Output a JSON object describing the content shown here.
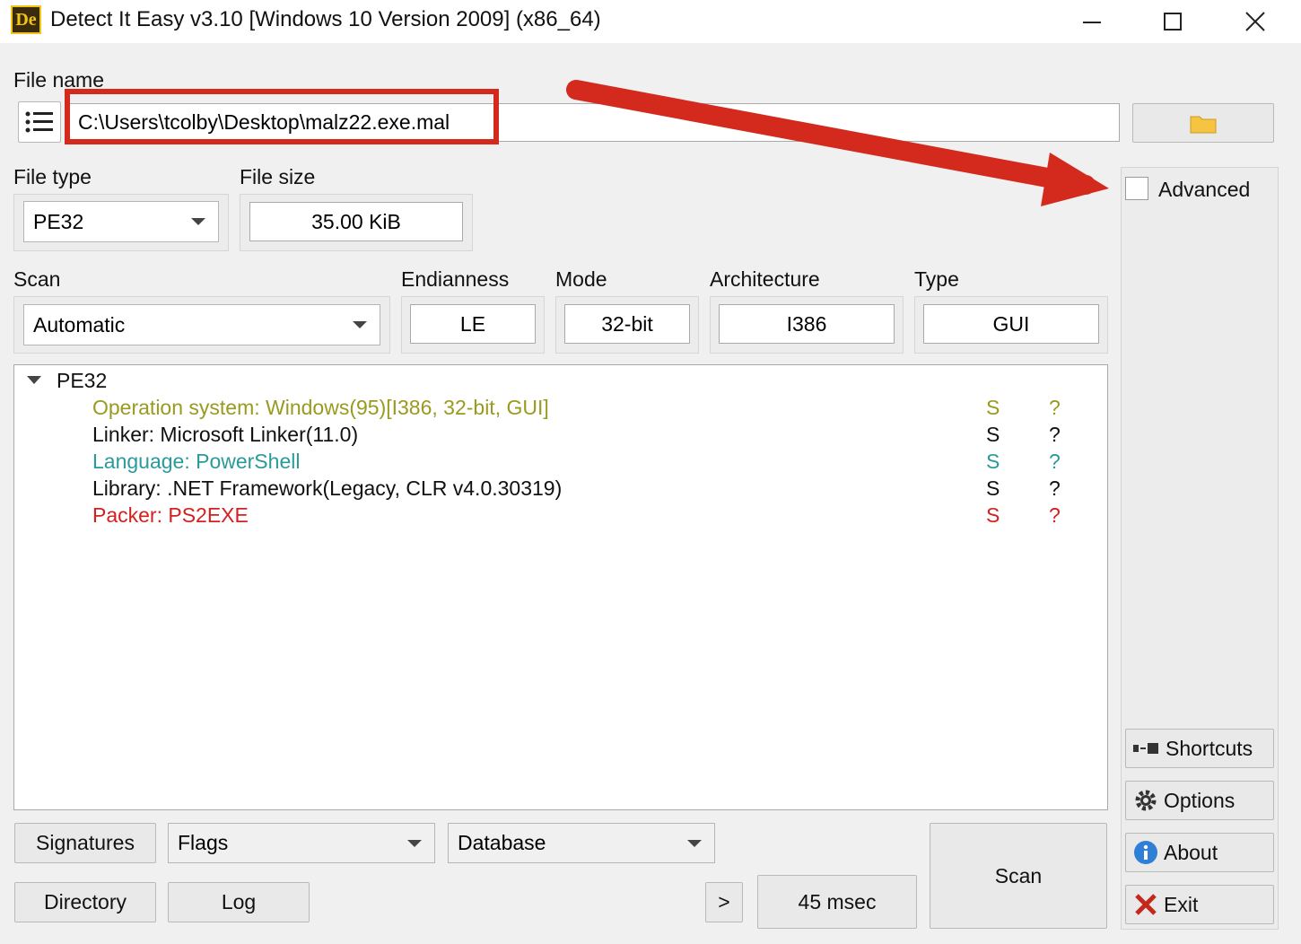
{
  "window": {
    "title": "Detect It Easy v3.10 [Windows 10 Version 2009] (x86_64)",
    "icon_text": "De"
  },
  "file": {
    "label": "File name",
    "path": "C:\\Users\\tcolby\\Desktop\\malz22.exe.mal"
  },
  "file_type": {
    "label": "File type",
    "value": "PE32"
  },
  "file_size": {
    "label": "File size",
    "value": "35.00 KiB"
  },
  "advanced": {
    "label": "Advanced",
    "checked": false
  },
  "scan": {
    "label": "Scan",
    "value": "Automatic"
  },
  "endianness": {
    "label": "Endianness",
    "value": "LE"
  },
  "mode": {
    "label": "Mode",
    "value": "32-bit"
  },
  "architecture": {
    "label": "Architecture",
    "value": "I386"
  },
  "type": {
    "label": "Type",
    "value": "GUI"
  },
  "results": {
    "root": "PE32",
    "items": [
      {
        "text": "Operation system: Windows(95)[I386, 32-bit, GUI]",
        "s": "S",
        "q": "?",
        "color": "#9a9a20"
      },
      {
        "text": "Linker: Microsoft Linker(11.0)",
        "s": "S",
        "q": "?",
        "color": "#111111"
      },
      {
        "text": "Language: PowerShell",
        "s": "S",
        "q": "?",
        "color": "#2a9a9a"
      },
      {
        "text": "Library: .NET Framework(Legacy, CLR v4.0.30319)",
        "s": "S",
        "q": "?",
        "color": "#111111"
      },
      {
        "text": "Packer: PS2EXE",
        "s": "S",
        "q": "?",
        "color": "#d42020"
      }
    ]
  },
  "bottom": {
    "signatures": "Signatures",
    "flags": "Flags",
    "database": "Database",
    "directory": "Directory",
    "log": "Log",
    "more": ">",
    "time": "45 msec",
    "scan": "Scan"
  },
  "side": {
    "shortcuts": "Shortcuts",
    "options": "Options",
    "about": "About",
    "exit": "Exit"
  },
  "colors": {
    "annotation_red": "#d42a1e"
  }
}
